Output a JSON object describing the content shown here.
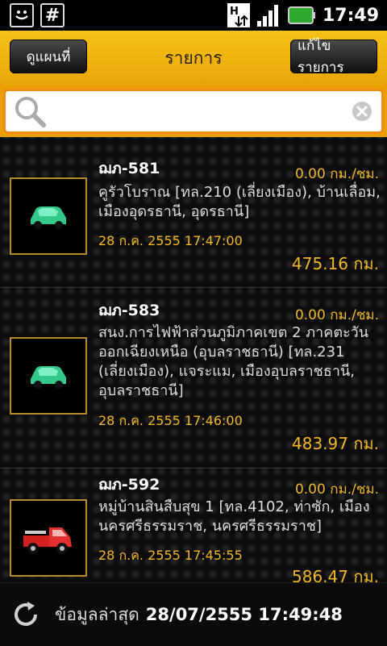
{
  "status": {
    "clock": "17:49",
    "hash_label": "#"
  },
  "header": {
    "map_button": "ดูแผนที่",
    "title": "รายการ",
    "edit_button": "แก้ไขรายการ"
  },
  "search": {
    "value": "",
    "placeholder": ""
  },
  "items": [
    {
      "plate_prefix": "ฌภ-",
      "plate_number": "581",
      "speed": "0.00 กม./ชม.",
      "place": "คูรัวโบราณ [ทล.210 (เลี่ยงเมือง), บ้านเลื่อม, เมืองอุดรธานี, อุดรธานี]",
      "time": "28 ก.ค. 2555 17:47:00",
      "distance": "475.16 กม.",
      "icon": "green-car-icon"
    },
    {
      "plate_prefix": "ฌภ-",
      "plate_number": "583",
      "speed": "0.00 กม./ชม.",
      "place": "สนง.การไฟฟ้าส่วนภูมิภาคเขต 2 ภาคตะวันออกเฉียงเหนือ (อุบลราชธานี) [ทล.231 (เลี่ยงเมือง), แจระแม, เมืองอุบลราชธานี, อุบลราชธานี]",
      "time": "28 ก.ค. 2555 17:46:00",
      "distance": "483.97 กม.",
      "icon": "green-car-icon"
    },
    {
      "plate_prefix": "ฌภ-",
      "plate_number": "592",
      "speed": "0.00 กม./ชม.",
      "place": "หมู่บ้านสินสืบสุข 1 [ทล.4102, ท่าซัก, เมืองนครศรีธรรมราช, นครศรีธรรมราช]",
      "time": "28 ก.ค. 2555 17:45:55",
      "distance": "586.47 กม.",
      "icon": "red-pickup-truck-icon"
    }
  ],
  "footer": {
    "updated_label": "ข้อมูลล่าสุด",
    "updated_value": "28/07/2555 17:49:48"
  },
  "colors": {
    "accent": "#f1b826",
    "title_bar": "#f2b417",
    "search_border": "#f28b14"
  }
}
